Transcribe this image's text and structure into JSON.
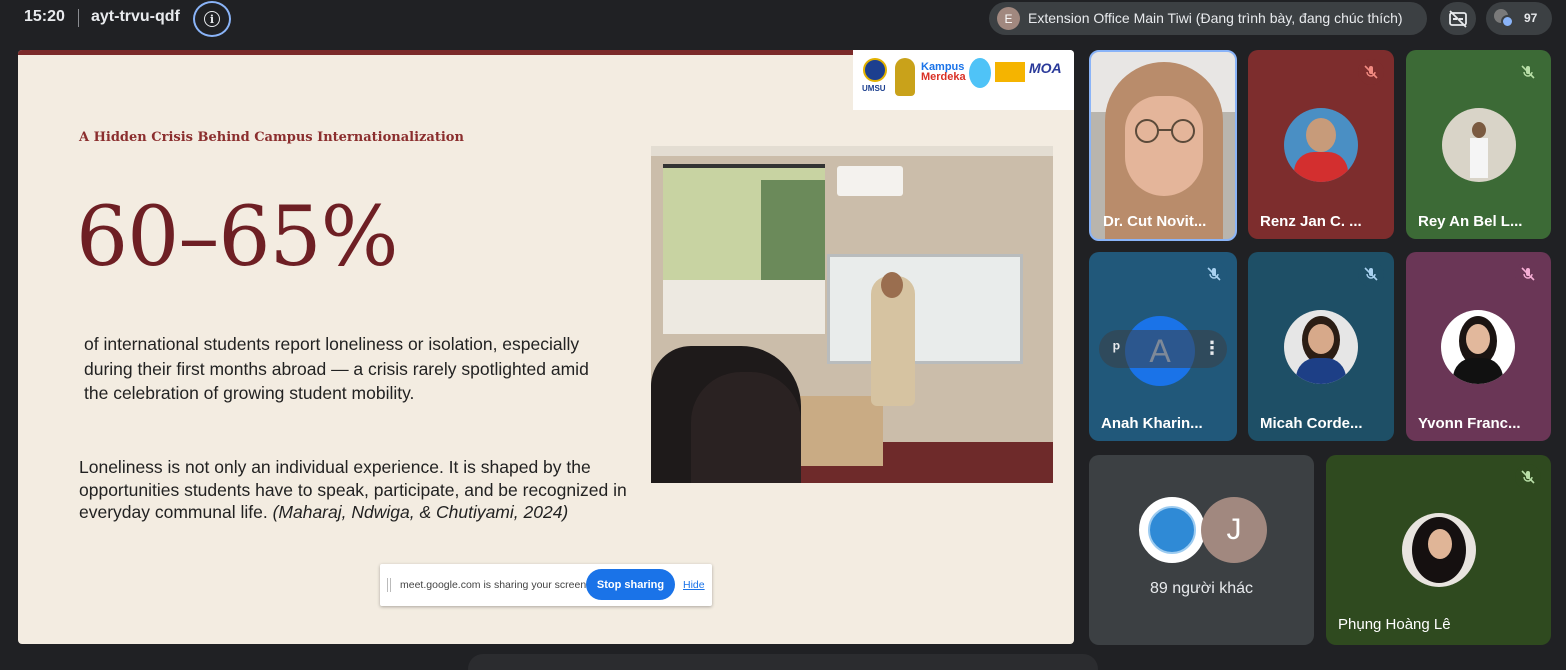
{
  "topbar": {
    "time": "15:20",
    "meeting_code": "ayt-trvu-qdf",
    "presenter_initial": "E",
    "presenter_text": "Extension Office Main Tiwi (Đang trình bày, đang chúc thích)",
    "participant_count": "97"
  },
  "slide": {
    "heading": "A Hidden Crisis Behind Campus Internationalization",
    "big_stat": "60–65%",
    "paragraph1": "of international students report loneliness or isolation, especially during their first months abroad — a crisis rarely spotlighted amid the celebration of growing student mobility.",
    "paragraph2": "Loneliness is not only an individual experience. It is shaped by the opportunities students have to speak, participate, and be recognized in everyday communal life.",
    "citation": "(Maharaj, Ndwiga, & Chutiyami, 2024)",
    "logo_umsu": "UMSU",
    "logo_kampus": "Kampus",
    "logo_merdeka": "Merdeka",
    "logo_moa": "MOA"
  },
  "share_bar": {
    "message": "meet.google.com is sharing your screen.",
    "stop_label": "Stop sharing",
    "hide_label": "Hide"
  },
  "participants": {
    "tile1": "Dr. Cut Novit...",
    "tile2": "Renz Jan C. ...",
    "tile3": "Rey An Bel L...",
    "tile4": "Anah Kharin...",
    "tile4_initial": "A",
    "tile5": "Micah Corde...",
    "tile6": "Yvonn Franc...",
    "others_initial": "J",
    "others_label": "89 người khác",
    "tile8": "Phụng Hoàng Lê"
  },
  "colors": {
    "accent_blue": "#1a73e8",
    "slide_bg": "#f3ece1",
    "heading_maroon": "#8b2e2e",
    "stat_maroon": "#6e1f24",
    "meet_dark": "#202124"
  }
}
